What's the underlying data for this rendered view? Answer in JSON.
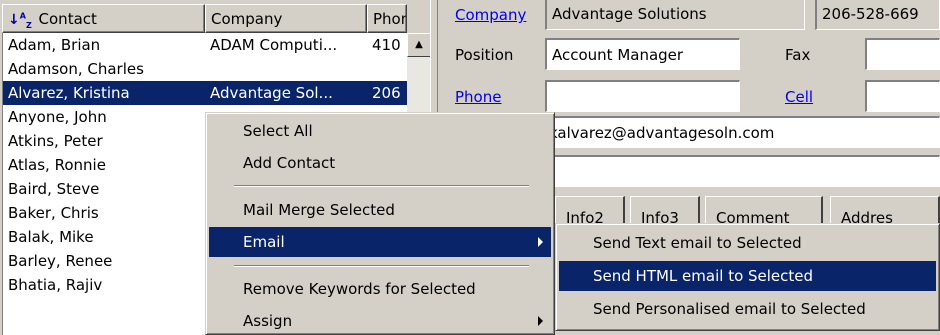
{
  "list": {
    "headers": {
      "contact": "Contact",
      "company": "Company",
      "phone": "Phone ("
    },
    "rows": [
      {
        "contact": "Adam, Brian",
        "company": "ADAM Computi...",
        "phone": "410"
      },
      {
        "contact": "Adamson, Charles",
        "company": "",
        "phone": ""
      },
      {
        "contact": "Alvarez, Kristina",
        "company": "Advantage Sol...",
        "phone": "206"
      },
      {
        "contact": "Anyone, John",
        "company": "",
        "phone": ""
      },
      {
        "contact": "Atkins, Peter",
        "company": "",
        "phone": ""
      },
      {
        "contact": "Atlas, Ronnie",
        "company": "",
        "phone": ""
      },
      {
        "contact": "Baird, Steve",
        "company": "",
        "phone": ""
      },
      {
        "contact": "Baker, Chris",
        "company": "",
        "phone": ""
      },
      {
        "contact": "Balak, Mike",
        "company": "",
        "phone": ""
      },
      {
        "contact": "Barley, Renee",
        "company": "",
        "phone": ""
      },
      {
        "contact": "Bhatia, Rajiv",
        "company": "",
        "phone": ""
      }
    ],
    "selected_index": 2
  },
  "detail": {
    "company_label": "Company",
    "company_value": "Advantage Solutions",
    "company_phone": "206-528-669",
    "position_label": "Position",
    "position_value": "Account Manager",
    "fax_label": "Fax",
    "phone_label": "Phone",
    "cell_label": "Cell",
    "email_value": "kalvarez@advantagesoln.com",
    "tabs": [
      "Info2",
      "Info3",
      "Comment",
      "Addres"
    ]
  },
  "context_menu": {
    "items": {
      "select_all": "Select All",
      "add_contact": "Add Contact",
      "mail_merge": "Mail Merge Selected",
      "email": "Email",
      "remove_keywords": "Remove Keywords for Selected",
      "assign": "Assign"
    }
  },
  "email_submenu": {
    "items": {
      "text": "Send Text email to Selected",
      "html": "Send HTML email to Selected",
      "personalised": "Send Personalised email to Selected"
    }
  },
  "colors": {
    "selection": "#0a246a",
    "link": "#0000ee",
    "face": "#d4d0c8"
  },
  "icons": {
    "sort": "sort-az-icon",
    "scroll_up": "scroll-up-arrow-icon",
    "submenu": "submenu-arrow-icon"
  }
}
